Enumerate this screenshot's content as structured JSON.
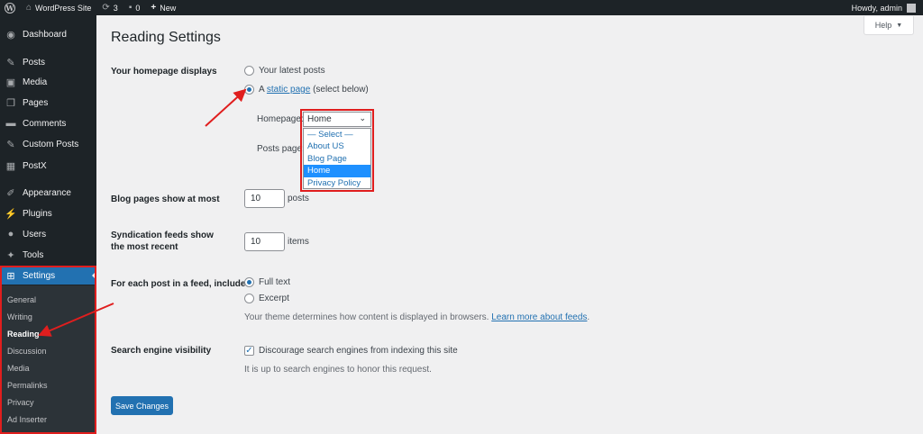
{
  "admin_bar": {
    "site_name": "WordPress Site",
    "updates_count": "3",
    "comments_count": "0",
    "new_label": "New",
    "greeting": "Howdy, admin"
  },
  "sidebar": {
    "menu": [
      {
        "label": "Dashboard",
        "icon": "dashboard-icon"
      },
      {
        "label": "Posts",
        "icon": "pushpin-icon"
      },
      {
        "label": "Media",
        "icon": "media-icon"
      },
      {
        "label": "Pages",
        "icon": "pages-icon"
      },
      {
        "label": "Comments",
        "icon": "comment-icon"
      },
      {
        "label": "Custom Posts",
        "icon": "pushpin-icon"
      },
      {
        "label": "PostX",
        "icon": "postx-icon"
      },
      {
        "label": "Appearance",
        "icon": "paintbrush-icon"
      },
      {
        "label": "Plugins",
        "icon": "plugin-icon"
      },
      {
        "label": "Users",
        "icon": "users-icon"
      },
      {
        "label": "Tools",
        "icon": "wrench-icon"
      },
      {
        "label": "Settings",
        "icon": "settings-icon"
      }
    ],
    "submenu": [
      "General",
      "Writing",
      "Reading",
      "Discussion",
      "Media",
      "Permalinks",
      "Privacy",
      "Ad Inserter"
    ],
    "current_submenu": "Reading"
  },
  "help_label": "Help",
  "page_title": "Reading Settings",
  "homepage": {
    "label": "Your homepage displays",
    "option_latest": "Your latest posts",
    "option_static_prefix": "A",
    "option_static_link": "static page",
    "option_static_suffix": "(select below)",
    "selected": "static",
    "homepage_label": "Homepage:",
    "homepage_value": "Home",
    "posts_page_label": "Posts page:",
    "dropdown_options": [
      "— Select —",
      "About US",
      "Blog Page",
      "Home",
      "Privacy Policy"
    ],
    "dropdown_highlighted": "Home"
  },
  "blog_pages": {
    "label": "Blog pages show at most",
    "value": "10",
    "unit": "posts"
  },
  "syndication": {
    "label": "Syndication feeds show the most recent",
    "value": "10",
    "unit": "items"
  },
  "feed": {
    "label": "For each post in a feed, include",
    "option_full": "Full text",
    "option_excerpt": "Excerpt",
    "selected": "full",
    "desc_prefix": "Your theme determines how content is displayed in browsers.",
    "desc_link": "Learn more about feeds",
    "desc_suffix": "."
  },
  "search_engine": {
    "label": "Search engine visibility",
    "checkbox_label": "Discourage search engines from indexing this site",
    "checked": true,
    "note": "It is up to search engines to honor this request."
  },
  "save_button": "Save Changes",
  "colors": {
    "accent": "#2271b1",
    "highlight_red": "#e01e1e",
    "sidebar_bg": "#1d2327"
  }
}
